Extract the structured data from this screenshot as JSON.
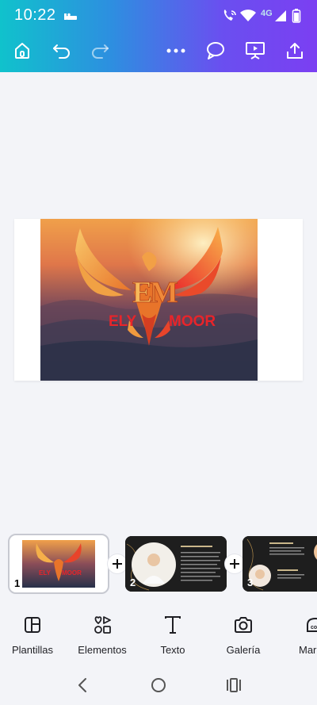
{
  "status_bar": {
    "time": "10:22",
    "network": "4G"
  },
  "toolbar": {
    "home": "home-icon",
    "undo": "undo-icon",
    "redo": "redo-icon",
    "more": "more-icon",
    "comment": "comment-icon",
    "present": "present-icon",
    "share": "share-icon"
  },
  "canvas": {
    "brand_left": "ELY",
    "brand_right": "MOOR"
  },
  "pages": [
    {
      "number": "1",
      "selected": true
    },
    {
      "number": "2",
      "selected": false
    },
    {
      "number": "3",
      "selected": false
    }
  ],
  "tools": [
    {
      "label": "Plantillas",
      "icon": "templates-icon"
    },
    {
      "label": "Elementos",
      "icon": "elements-icon"
    },
    {
      "label": "Texto",
      "icon": "text-icon"
    },
    {
      "label": "Galería",
      "icon": "camera-icon"
    },
    {
      "label": "Mar",
      "icon": "brand-icon"
    }
  ],
  "colors": {
    "accent_start": "#10c2cc",
    "accent_end": "#7b3ff2",
    "brand_red": "#e8242a"
  }
}
